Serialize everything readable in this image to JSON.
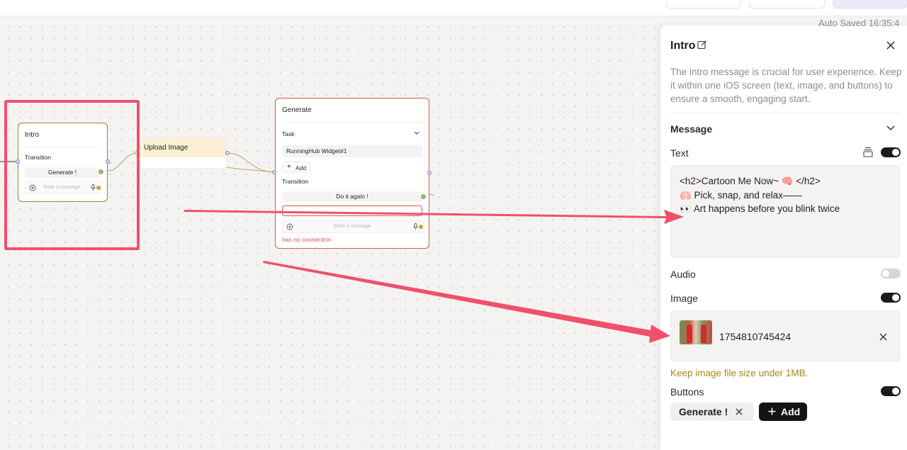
{
  "autosave_text": "Auto Saved 16:35:4",
  "canvas": {
    "intro_node": {
      "title": "Intro",
      "transition_label": "Transition",
      "button_label": "Generate !",
      "message_placeholder": "Write a message"
    },
    "upload_node": {
      "title": "Upload Image"
    },
    "generate_node": {
      "title": "Generate",
      "task_label": "Task",
      "task_value": "RunningHub Widget#1",
      "add_label": "Add",
      "transition_label": "Transition",
      "button_label": "Do it again !",
      "message_placeholder": "Write a message",
      "error_text": "has no connection"
    }
  },
  "panel": {
    "title": "Intro",
    "description": "The intro message is crucial for user experience. Keep it within one iOS screen (text, image, and buttons) to ensure a smooth, engaging start.",
    "section_title": "Message",
    "text_label": "Text",
    "text_value": "<h2>Cartoon Me Now~ 🧠 </h2>\n🫁 Pick, snap, and relax——\n👀 Art happens before you blink twice",
    "audio_label": "Audio",
    "image_label": "Image",
    "image_file_name": "1754810745424",
    "image_note": "Keep image file size under 1MB.",
    "buttons_label": "Buttons",
    "button_chip_label": "Generate !",
    "add_button_label": "Add",
    "toggles": {
      "text": true,
      "audio": false,
      "image": true,
      "buttons": true
    }
  },
  "colors": {
    "annotation": "#f0506b",
    "intro_border": "#9a8236",
    "generate_border": "#d6574e",
    "upload_header": "#fdefd3",
    "warning_text": "#a6861f",
    "error_text": "#d6574e",
    "toggle_on": "#1b1b1b",
    "toggle_off": "#d6d6d6"
  },
  "icons": [
    "edit-icon",
    "close-icon",
    "chevron-down-icon",
    "stack-icon",
    "plus-circle-icon",
    "mic-icon",
    "plus-icon"
  ]
}
